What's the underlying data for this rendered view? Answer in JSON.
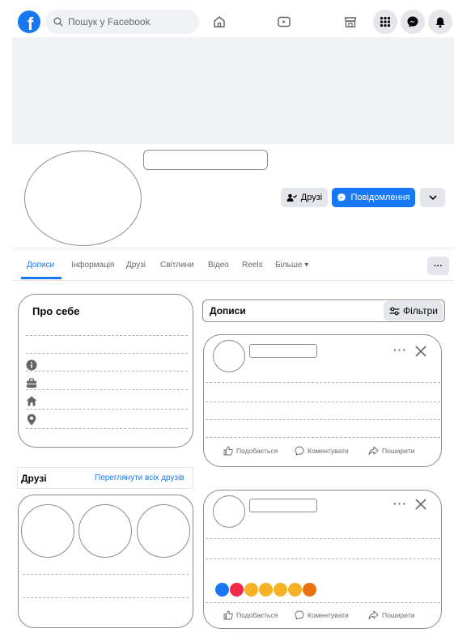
{
  "topbar": {
    "search_placeholder": "Пошук у Facebook",
    "logo_letter": "f",
    "icons": [
      "home-icon",
      "watch-icon",
      "marketplace-icon",
      "menu-grid-icon",
      "messenger-icon",
      "notifications-icon"
    ]
  },
  "profile": {
    "friends_button": "Друзі",
    "message_button": "Повідомлення"
  },
  "tabs": [
    {
      "label": "Дописи",
      "active": true
    },
    {
      "label": "Інформація",
      "active": false
    },
    {
      "label": "Друзі",
      "active": false
    },
    {
      "label": "Світлини",
      "active": false
    },
    {
      "label": "Відео",
      "active": false
    },
    {
      "label": "Reels",
      "active": false
    },
    {
      "label": "Більше ▾",
      "active": false
    }
  ],
  "more_tab_button": "···",
  "about": {
    "title": "Про себе",
    "icons": [
      "info-icon",
      "work-icon",
      "home-icon",
      "location-icon"
    ]
  },
  "friends": {
    "title": "Друзі",
    "see_all": "Переглянути всіх друзів"
  },
  "posts": {
    "title": "Дописи",
    "filters_label": "Фільтри",
    "items": [
      {
        "like": "Подобається",
        "comment": "Коментувати",
        "share": "Поширити"
      },
      {
        "like": "Подобається",
        "comment": "Коментувати",
        "share": "Поширити",
        "reactions": [
          "like",
          "love",
          "care",
          "haha",
          "wow",
          "sad",
          "angry"
        ]
      }
    ]
  },
  "colors": {
    "brand": "#1877f2",
    "button_gray": "#e4e6eb",
    "outline": "#8a8d91",
    "muted_text": "#65676b"
  }
}
